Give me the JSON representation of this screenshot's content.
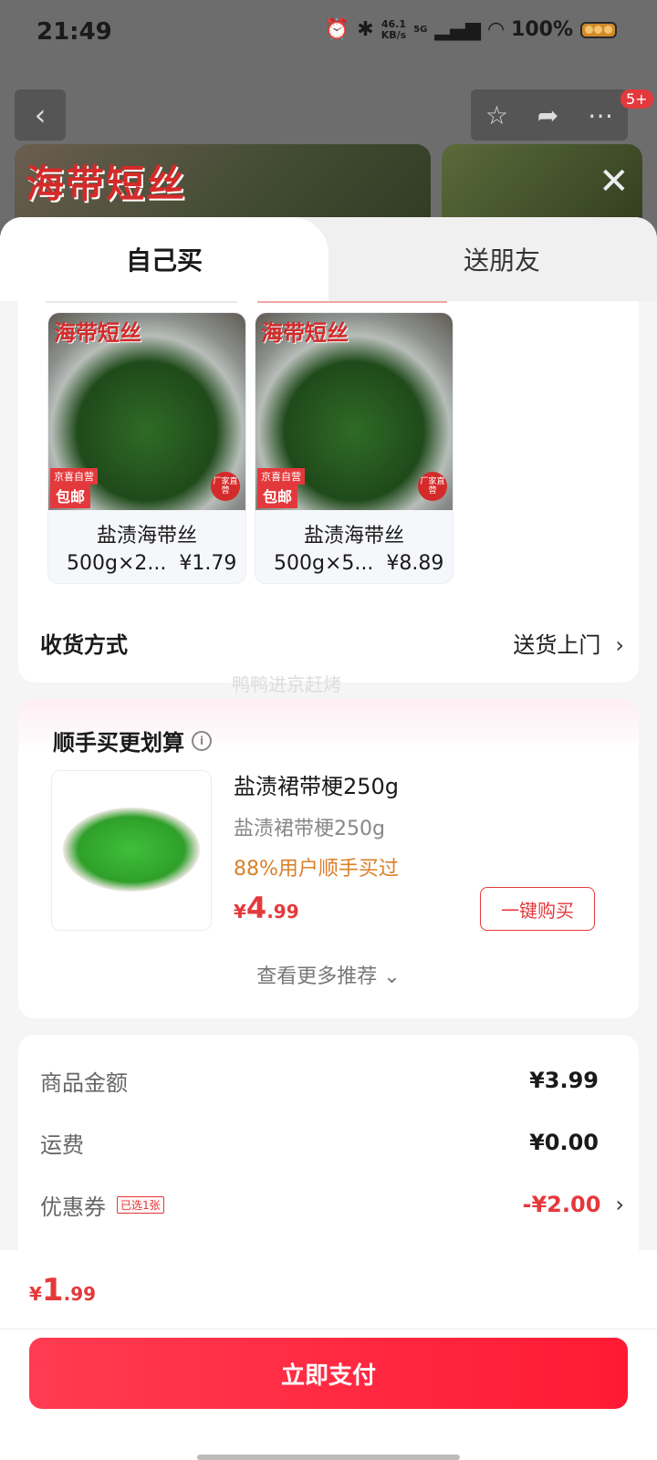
{
  "status_bar": {
    "time": "21:49",
    "net_speed_value": "46.1",
    "net_speed_unit": "KB/s",
    "network": "5G",
    "battery": "100%"
  },
  "background": {
    "hero_title": "海带短丝",
    "badge": "5+"
  },
  "tabs": [
    {
      "label": "自己买"
    },
    {
      "label": "送朋友"
    }
  ],
  "skus": [
    {
      "brand": "海带短丝",
      "tag_top": "京喜自营",
      "tag_bottom": "包邮",
      "seal": "厂家直营",
      "name": "盐渍海带丝",
      "spec": "500g×2...",
      "price": "¥1.79"
    },
    {
      "brand": "海带短丝",
      "tag_top": "京喜自营",
      "tag_bottom": "包邮",
      "seal": "厂家直营",
      "name": "盐渍海带丝",
      "spec": "500g×5...",
      "price": "¥8.89"
    }
  ],
  "delivery": {
    "label": "收货方式",
    "value": "送货上门"
  },
  "watermark": "鸭鸭进京赶烤",
  "recommend": {
    "title": "顺手买更划算",
    "product_name": "盐渍裙带梗250g",
    "product_sub": "盐渍裙带梗250g",
    "hint": "88%用户顺手买过",
    "price_currency": "¥",
    "price_int": "4",
    "price_dec": ".99",
    "buy_label": "一键购买",
    "more_label": "查看更多推荐"
  },
  "summary": {
    "goods_label": "商品金额",
    "goods_value": "¥3.99",
    "shipping_label": "运费",
    "shipping_value": "¥0.00",
    "coupon_label": "优惠券",
    "coupon_tag": "已选1张",
    "coupon_value": "-¥2.00"
  },
  "footer": {
    "currency": "¥",
    "total_int": "1",
    "total_dec": ".99",
    "pay_label": "立即支付"
  },
  "colors": {
    "accent": "#e4393c",
    "pay_button": "#ff2a41",
    "hint": "#d9802a"
  }
}
